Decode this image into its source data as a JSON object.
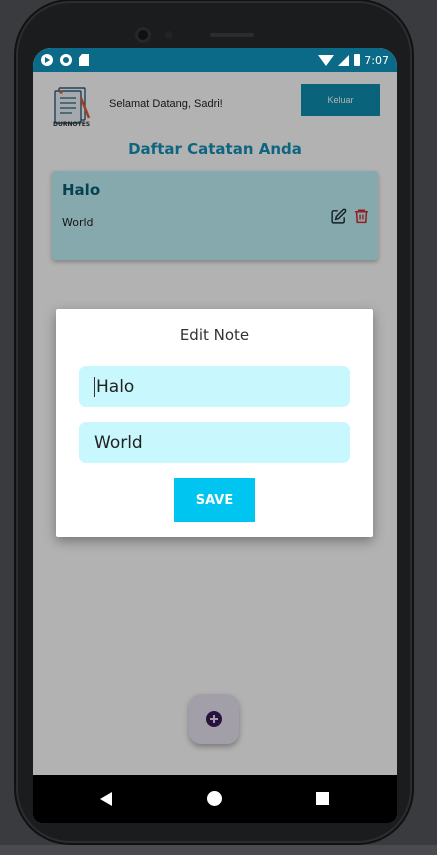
{
  "status_bar": {
    "time": "7:07"
  },
  "header": {
    "logo_text": "DURNOTES",
    "welcome_text": "Selamat Datang, Sadri!",
    "logout_label": "Keluar"
  },
  "main": {
    "title": "Daftar Catatan Anda",
    "notes": [
      {
        "title": "Halo",
        "body": "World"
      }
    ]
  },
  "dialog": {
    "title": "Edit Note",
    "title_field_value": "Halo",
    "body_field_value": "World",
    "save_label": "SAVE"
  },
  "colors": {
    "status_bar": "#0a6a87",
    "accent": "#1591b8",
    "logout_button": "#0c8fb1",
    "note_card": "#bff3f7",
    "input_background": "#c8f8fd",
    "save_button": "#00c5f0",
    "delete_icon": "#d32f2f",
    "fab_icon": "#3b1b5c"
  },
  "icons": {
    "status_bar": [
      "play-icon",
      "record-icon",
      "sd-card-icon",
      "wifi-icon",
      "signal-icon",
      "battery-icon"
    ],
    "note_actions": [
      "edit-icon",
      "delete-icon"
    ],
    "fab": "add-icon",
    "nav": [
      "back-icon",
      "home-icon",
      "recents-icon"
    ]
  }
}
